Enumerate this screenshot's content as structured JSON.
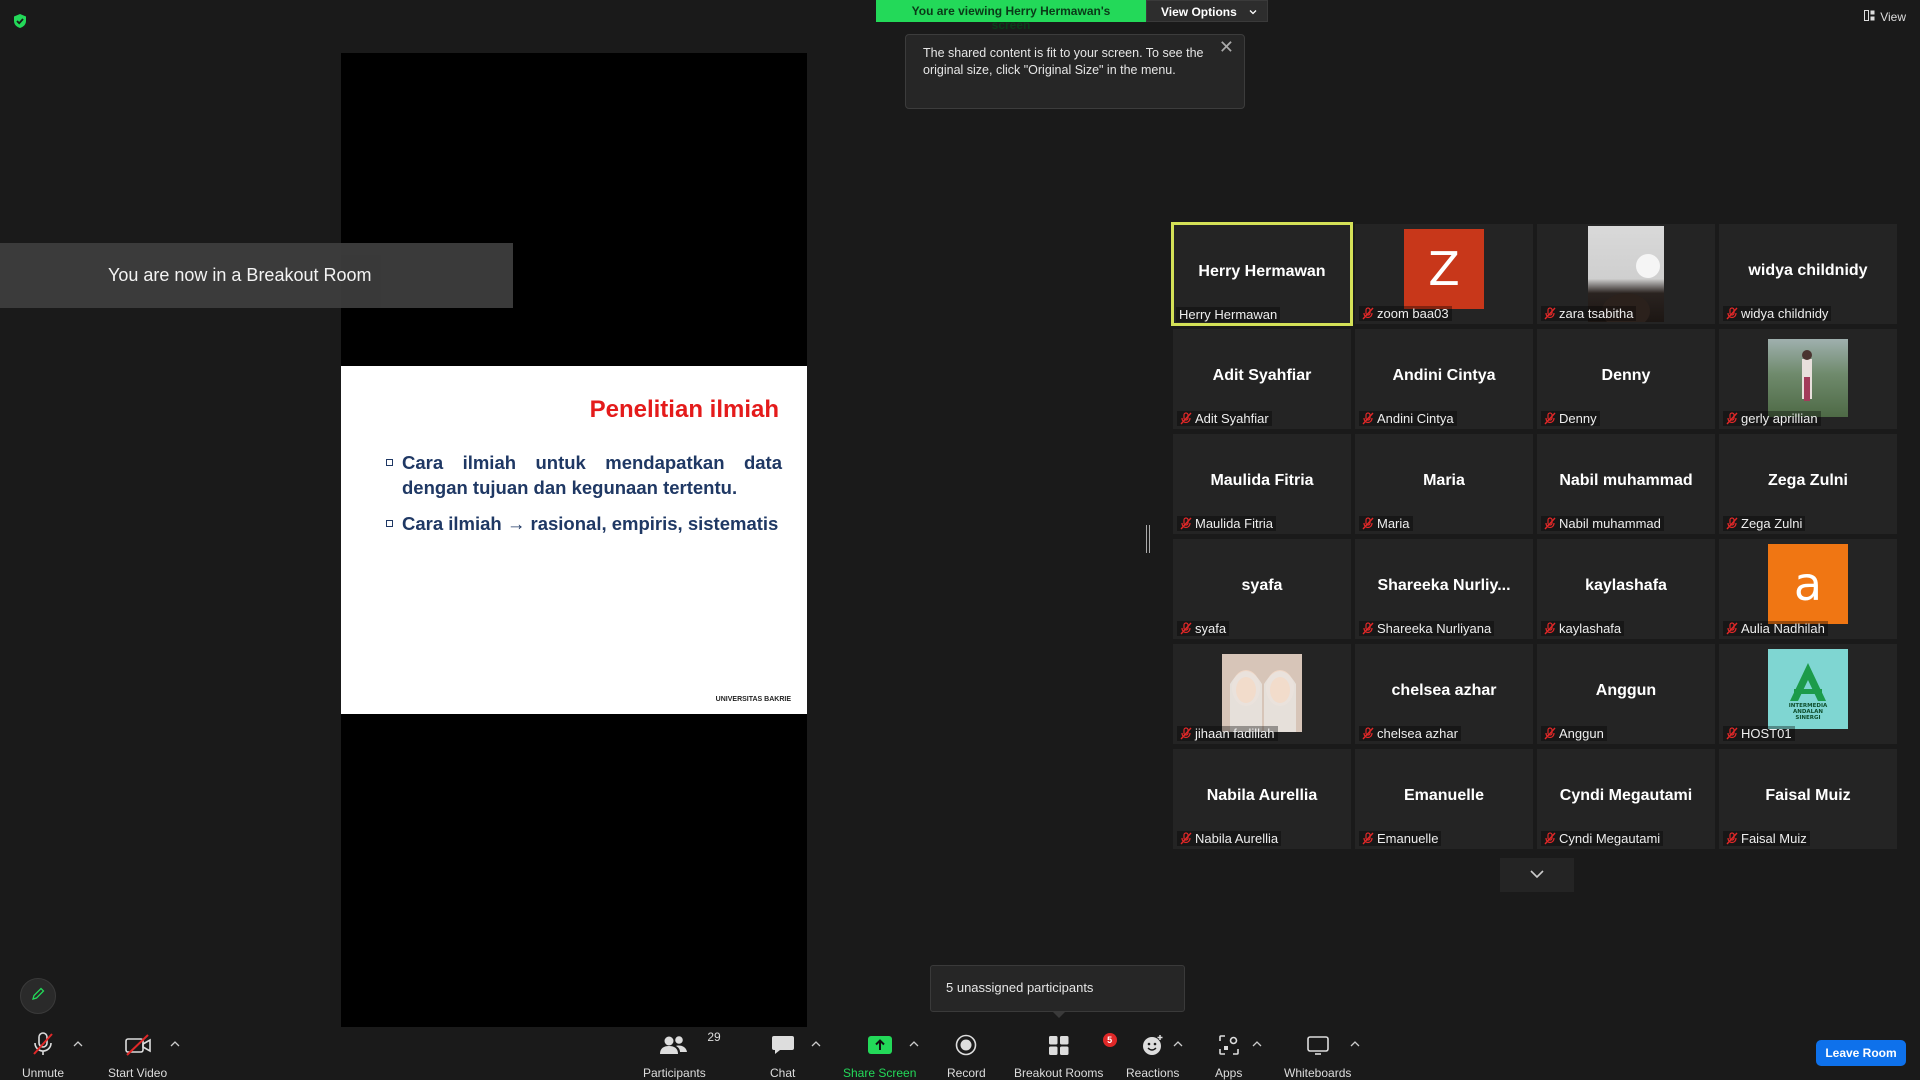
{
  "banner": {
    "viewing_text": "You are viewing Herry Hermawan's screen",
    "view_options_label": "View Options",
    "view_label": "View"
  },
  "tooltip": {
    "text": "The shared content is fit to your screen. To see the original size, click \"Original Size\" in the menu."
  },
  "slide": {
    "title": "Penelitian ilmiah",
    "bullet1_line1": "Cara ilmiah untuk mendapatkan data",
    "bullet1_line2": "dengan tujuan dan kegunaan tertentu.",
    "bullet2": "Cara ilmiah → rasional, empiris, sistematis",
    "footer": "UNIVERSITAS BAKRIE"
  },
  "breakout_notice": "You are now in a Breakout Room",
  "gallery": {
    "tiles": [
      {
        "name": "Herry Hermawan",
        "label": "Herry Hermawan",
        "muted": false,
        "active": true,
        "kind": "name"
      },
      {
        "name": "",
        "label": "zoom baa03",
        "muted": true,
        "kind": "avatar",
        "letter": "Z",
        "color": "#c8371a"
      },
      {
        "name": "",
        "label": "zara tsabitha",
        "muted": true,
        "kind": "photo",
        "photo": "face"
      },
      {
        "name": "widya childnidy",
        "label": "widya childnidy",
        "muted": true,
        "kind": "name"
      },
      {
        "name": "Adit Syahfiar",
        "label": "Adit Syahfiar",
        "muted": true,
        "kind": "name"
      },
      {
        "name": "Andini Cintya",
        "label": "Andini Cintya",
        "muted": true,
        "kind": "name"
      },
      {
        "name": "Denny",
        "label": "Denny",
        "muted": true,
        "kind": "name"
      },
      {
        "name": "",
        "label": "gerly aprillian",
        "muted": true,
        "kind": "photo",
        "photo": "outdoor"
      },
      {
        "name": "Maulida Fitria",
        "label": "Maulida Fitria",
        "muted": true,
        "kind": "name"
      },
      {
        "name": "Maria",
        "label": "Maria",
        "muted": true,
        "kind": "name"
      },
      {
        "name": "Nabil muhammad",
        "label": "Nabil muhammad",
        "muted": true,
        "kind": "name"
      },
      {
        "name": "Zega Zulni",
        "label": "Zega Zulni",
        "muted": true,
        "kind": "name"
      },
      {
        "name": "syafa",
        "label": "syafa",
        "muted": true,
        "kind": "name"
      },
      {
        "name": "Shareeka  Nurliy...",
        "label": "Shareeka Nurliyana",
        "muted": true,
        "kind": "name"
      },
      {
        "name": "kaylashafa",
        "label": "kaylashafa",
        "muted": true,
        "kind": "name"
      },
      {
        "name": "",
        "label": "Aulia Nadhilah",
        "muted": true,
        "kind": "avatar",
        "letter": "a",
        "color": "#f07613"
      },
      {
        "name": "",
        "label": "jihaan fadillah",
        "muted": true,
        "kind": "photo",
        "photo": "duo"
      },
      {
        "name": "chelsea azhar",
        "label": "chelsea azhar",
        "muted": true,
        "kind": "name"
      },
      {
        "name": "Anggun",
        "label": "Anggun",
        "muted": true,
        "kind": "name"
      },
      {
        "name": "",
        "label": "HOST01",
        "muted": true,
        "kind": "logo",
        "logo_text": "INTERMEDIA ANDALAN SINERGI"
      },
      {
        "name": "Nabila Aurellia",
        "label": "Nabila Aurellia",
        "muted": true,
        "kind": "name"
      },
      {
        "name": "Emanuelle",
        "label": "Emanuelle",
        "muted": true,
        "kind": "name"
      },
      {
        "name": "Cyndi Megautami",
        "label": "Cyndi Megautami",
        "muted": true,
        "kind": "name"
      },
      {
        "name": "Faisal Muiz",
        "label": "Faisal Muiz",
        "muted": true,
        "kind": "name"
      }
    ]
  },
  "unassigned": "5 unassigned participants",
  "toolbar": {
    "unmute": "Unmute",
    "start_video": "Start Video",
    "participants": "Participants",
    "participants_count": "29",
    "chat": "Chat",
    "share_screen": "Share Screen",
    "record": "Record",
    "breakout_rooms": "Breakout Rooms",
    "breakout_count": "5",
    "reactions": "Reactions",
    "apps": "Apps",
    "whiteboards": "Whiteboards",
    "leave_room": "Leave Room"
  },
  "colors": {
    "accent_green": "#23d959",
    "active_speaker": "#d4e157",
    "leave_blue": "#0e71eb",
    "mute_red": "#e02828"
  }
}
